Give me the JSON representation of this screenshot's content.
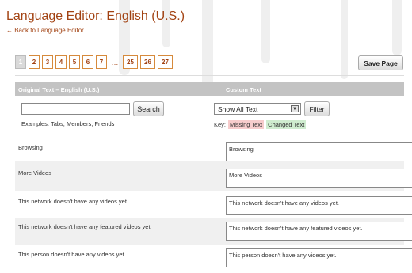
{
  "header": {
    "title": "Language Editor: English (U.S.)",
    "back_link": "← Back to Language Editor"
  },
  "pager": {
    "pages": [
      "1",
      "2",
      "3",
      "4",
      "5",
      "6",
      "7",
      "…",
      "25",
      "26",
      "27"
    ],
    "current": "1"
  },
  "toolbar": {
    "save_label": "Save Page"
  },
  "table": {
    "col_original": "Original Text – English (U.S.)",
    "col_custom": "Custom Text"
  },
  "search": {
    "value": "",
    "button": "Search",
    "examples": "Examples: Tabs, Members, Friends"
  },
  "filter": {
    "selected": "Show All Text",
    "button": "Filter",
    "key_label": "Key:",
    "missing_label": "Missing Text",
    "changed_label": "Changed Text"
  },
  "rows": [
    {
      "original": "Browsing",
      "custom": "Browsing"
    },
    {
      "original": "More Videos",
      "custom": "More Videos"
    },
    {
      "original": "This network doesn't have any videos yet.",
      "custom": "This network doesn't have any videos yet."
    },
    {
      "original": "This network doesn't have any featured videos yet.",
      "custom": "This network doesn't have any featured videos yet."
    },
    {
      "original": "This person doesn't have any videos yet.",
      "custom": "This person doesn't have any videos yet."
    }
  ],
  "colors": {
    "accent": "#a24212",
    "header_bg": "#c3c3c3",
    "missing": "#f7cccc",
    "changed": "#cfeccf"
  }
}
